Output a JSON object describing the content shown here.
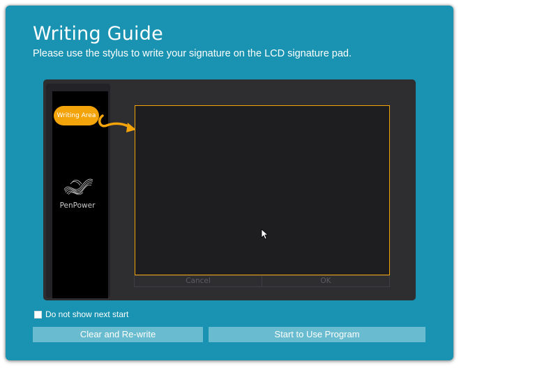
{
  "window": {
    "title": "Writing Guide",
    "subtitle": "Please use the stylus to write your signature on the LCD signature pad."
  },
  "device": {
    "callout_label": "Writing Area",
    "brand": "PenPower",
    "pad_buttons": {
      "cancel": "Cancel",
      "ok": "OK"
    }
  },
  "options": {
    "do_not_show_label": "Do not show next start",
    "do_not_show_checked": false
  },
  "actions": {
    "clear_label": "Clear and Re-write",
    "start_label": "Start to Use Program"
  },
  "colors": {
    "background": "#1993b1",
    "accent": "#f4a40b",
    "button": "#69bcd0",
    "device": "#2e2d30"
  },
  "icons": {
    "logo": "penpower-logo-icon",
    "arrow": "curved-arrow-icon",
    "cursor": "mouse-pointer-icon"
  }
}
